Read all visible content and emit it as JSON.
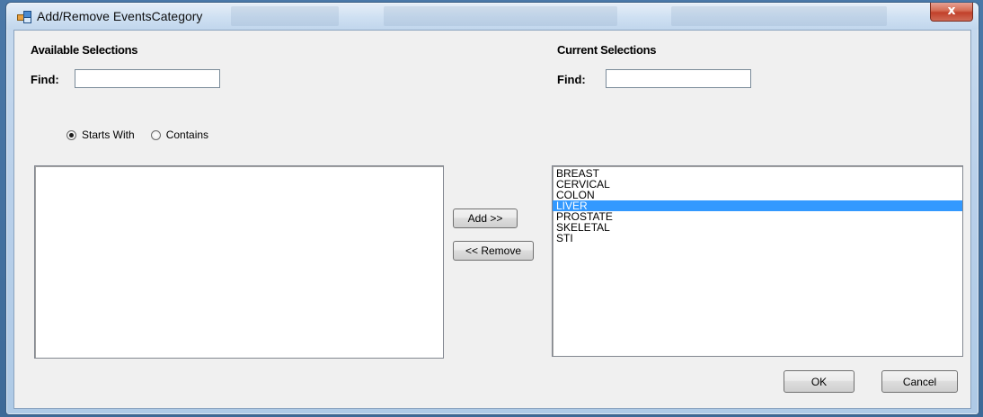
{
  "window": {
    "title": "Add/Remove EventsCategory",
    "close_label": "x"
  },
  "available": {
    "heading": "Available Selections",
    "find_label": "Find:",
    "find_value": "",
    "radio_starts_with": "Starts With",
    "radio_contains": "Contains",
    "selected_mode": "Starts With",
    "items": []
  },
  "current": {
    "heading": "Current Selections",
    "find_label": "Find:",
    "find_value": "",
    "items": [
      "BREAST",
      "CERVICAL",
      "COLON",
      "LIVER",
      "PROSTATE",
      "SKELETAL",
      "STI"
    ],
    "selected_item": "LIVER"
  },
  "buttons": {
    "add": "Add >>",
    "remove": "<< Remove",
    "ok": "OK",
    "cancel": "Cancel"
  },
  "colors": {
    "selection": "#3399ff",
    "client_bg": "#f0f0f0",
    "titlebar": "#c7daee"
  },
  "icons": {
    "app": "window-app-icon",
    "close": "close-icon"
  }
}
